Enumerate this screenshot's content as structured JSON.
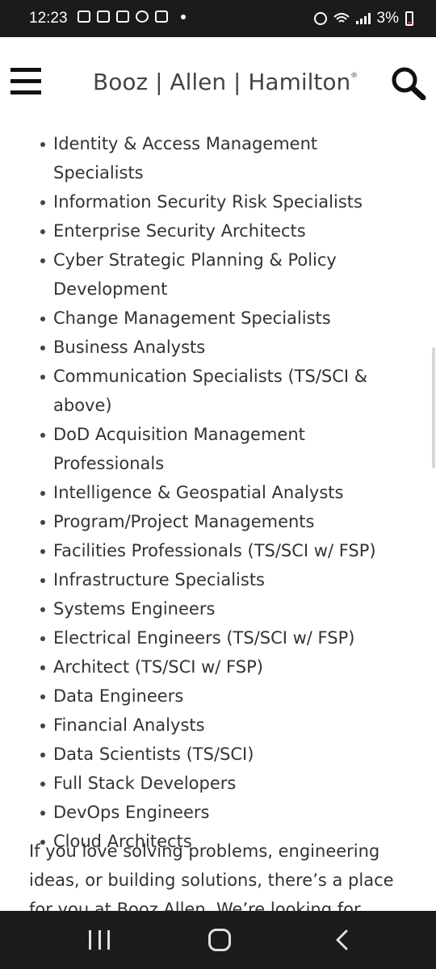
{
  "status_bar": {
    "time": "12:23",
    "battery_percent": "3%",
    "battery_level": 0.03
  },
  "header": {
    "logo": {
      "part1": "Booz",
      "part2": "Allen",
      "part3": "Hamilton",
      "mark": "®"
    }
  },
  "roles": [
    "Identity & Access Management Specialists",
    "Information Security Risk Specialists",
    "Enterprise Security Architects",
    "Cyber Strategic Planning & Policy Development",
    "Change Management Specialists",
    "Business Analysts",
    "Communication Specialists (TS/SCI & above)",
    "DoD Acquisition Management Professionals",
    "Intelligence & Geospatial Analysts",
    "Program/Project Managements",
    "Facilities Professionals (TS/SCI w/ FSP)",
    "Infrastructure Specialists",
    "Systems Engineers",
    "Electrical Engineers (TS/SCI w/ FSP)",
    "Architect (TS/SCI w/ FSP)",
    "Data Engineers",
    "Financial Analysts",
    "Data Scientists (TS/SCI)",
    "Full Stack Developers",
    "DevOps Engineers",
    "Cloud Architects"
  ],
  "paragraph": "If you love solving problems, engineering ideas, or building solutions, there’s a place for you at Booz Allen. We’re looking for passionate",
  "icons": {
    "menu": "hamburger-menu-icon",
    "search": "search-icon",
    "recents": "recents-icon",
    "home": "home-icon",
    "back": "back-icon"
  },
  "colors": {
    "status_bar_bg": "#1b1b1b",
    "nav_bar_bg": "#1c1c1c",
    "text": "#333333",
    "logo_text": "#444444",
    "battery_low": "#e53935"
  }
}
